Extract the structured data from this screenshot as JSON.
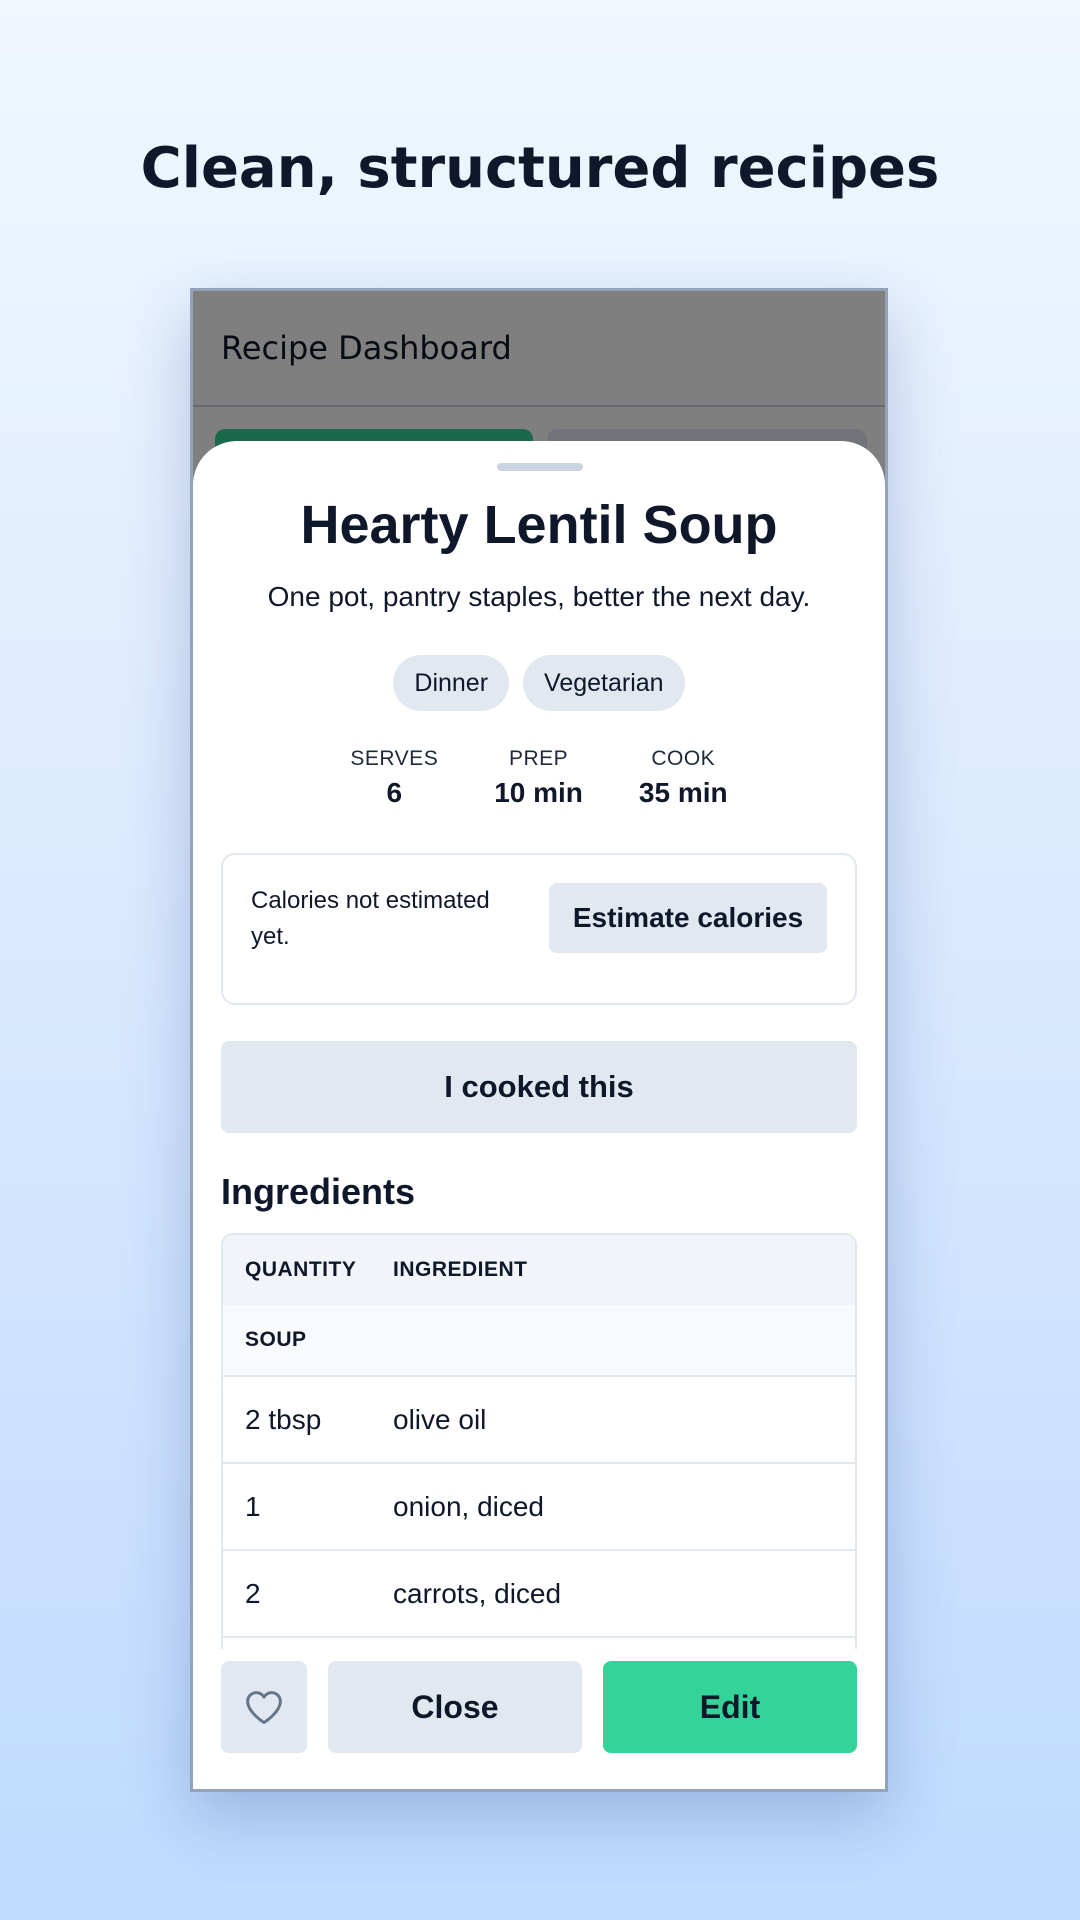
{
  "page": {
    "headline": "Clean, structured recipes"
  },
  "app": {
    "header_title": "Recipe Dashboard"
  },
  "recipe": {
    "title": "Hearty Lentil Soup",
    "subtitle": "One pot, pantry staples, better the next day.",
    "tags": [
      "Dinner",
      "Vegetarian"
    ],
    "stats": [
      {
        "label": "SERVES",
        "value": "6"
      },
      {
        "label": "PREP",
        "value": "10 min"
      },
      {
        "label": "COOK",
        "value": "35 min"
      }
    ]
  },
  "calories": {
    "status_text": "Calories not estimated yet.",
    "button_label": "Estimate calories"
  },
  "actions": {
    "cooked_label": "I cooked this",
    "close_label": "Close",
    "edit_label": "Edit",
    "favorite_icon": "heart-icon"
  },
  "ingredients": {
    "section_title": "Ingredients",
    "columns": [
      "QUANTITY",
      "INGREDIENT"
    ],
    "group_name": "SOUP",
    "rows": [
      {
        "quantity": "2 tbsp",
        "ingredient": "olive oil"
      },
      {
        "quantity": "1",
        "ingredient": "onion, diced"
      },
      {
        "quantity": "2",
        "ingredient": "carrots, diced"
      }
    ]
  },
  "colors": {
    "accent": "#34d399",
    "button_neutral": "#e2e8f0",
    "text": "#0f172a"
  }
}
